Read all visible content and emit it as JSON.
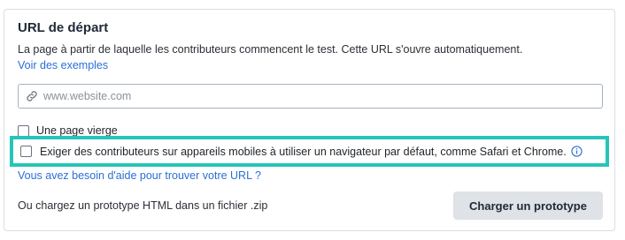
{
  "section": {
    "title": "URL de départ",
    "description": "La page à partir de laquelle les contributeurs commencent le test. Cette URL s'ouvre automatiquement.",
    "examples_link": "Voir des exemples"
  },
  "url_input": {
    "placeholder": "www.website.com",
    "value": ""
  },
  "options": {
    "blank_page_label": "Une page vierge",
    "mobile_browser_label": "Exiger des contributeurs sur appareils mobiles à utiliser un navigateur par défaut, comme Safari et Chrome."
  },
  "help_link": "Vous avez besoin d'aide pour trouver votre URL ?",
  "prototype": {
    "text": "Ou chargez un prototype HTML dans un fichier .zip",
    "button_label": "Charger un prototype"
  },
  "colors": {
    "link": "#2b6fd6",
    "highlight": "#26c5b8",
    "button_bg": "#dfe2e6"
  }
}
